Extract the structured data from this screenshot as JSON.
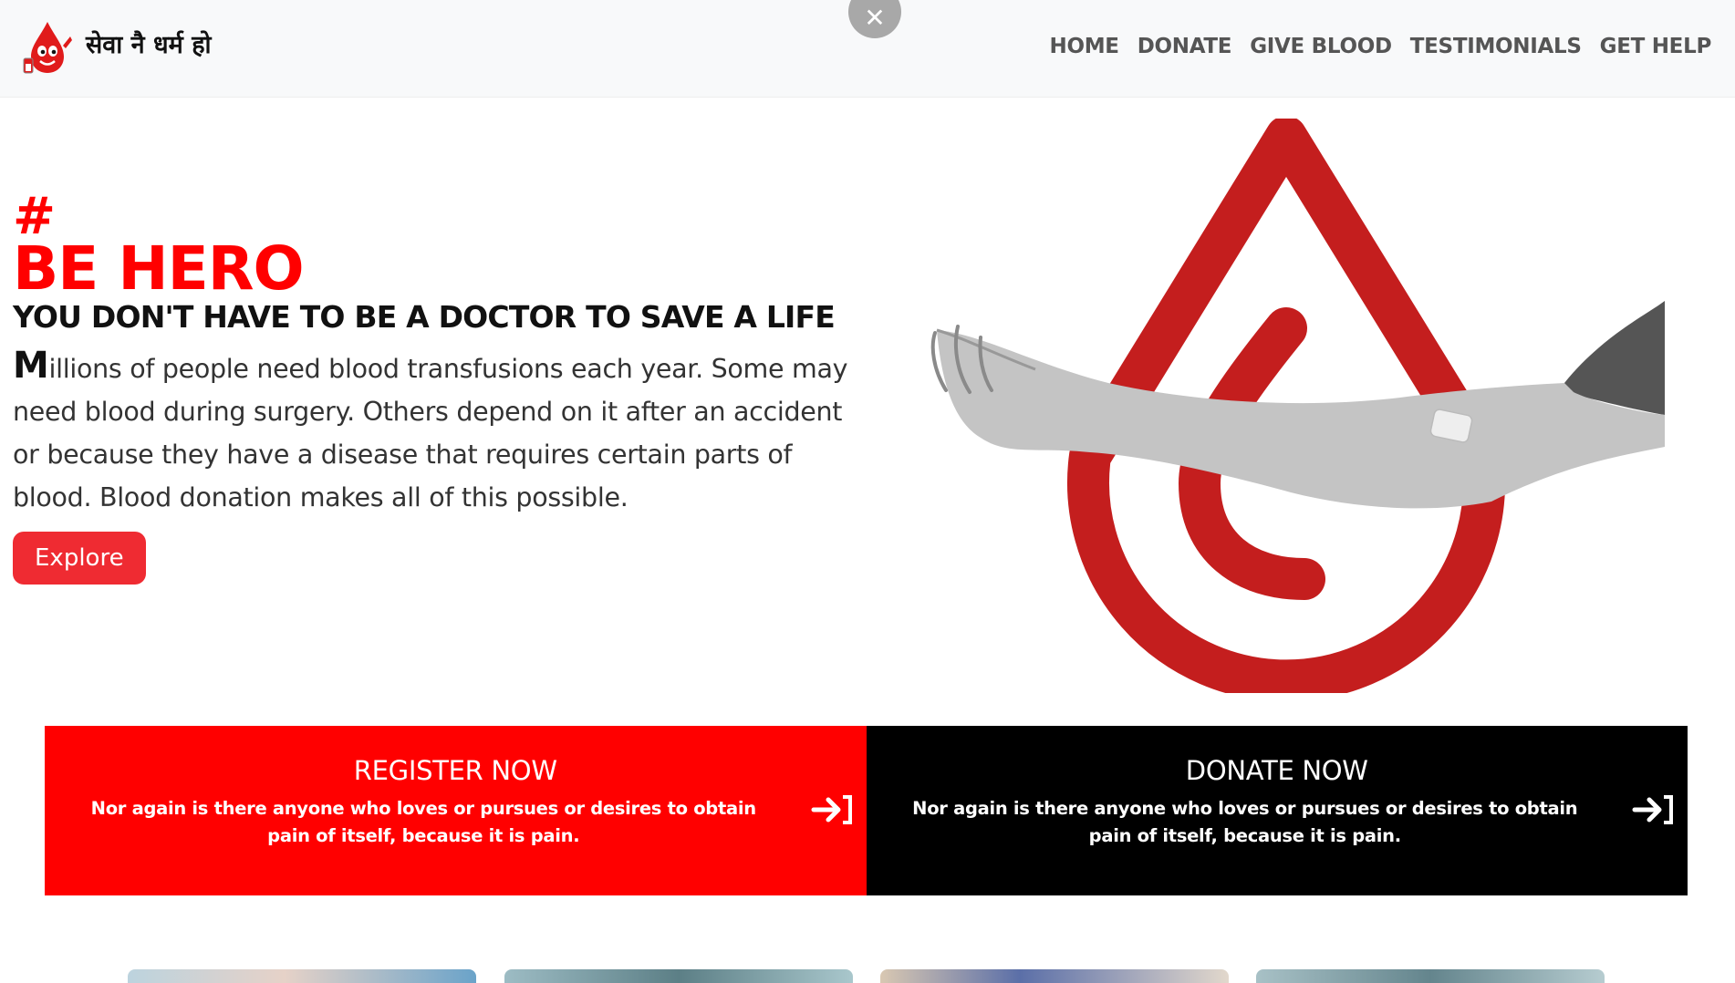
{
  "brand": {
    "text": "सेवा नै धर्म हो",
    "logo_icon": "blood-drop-mascot-icon"
  },
  "close_icon": "close-icon",
  "close_glyph": "✕",
  "nav": {
    "items": [
      {
        "label": "HOME"
      },
      {
        "label": "DONATE"
      },
      {
        "label": "GIVE BLOOD"
      },
      {
        "label": "TESTIMONIALS"
      },
      {
        "label": "GET HELP"
      }
    ]
  },
  "hero": {
    "hash": "#",
    "title": "BE HERO",
    "subtitle": "YOU DON'T HAVE TO BE A DOCTOR TO SAVE A LIFE",
    "dropcap": "M",
    "paragraph": "illions of people need blood transfusions each year. Some may need blood during surgery. Others depend on it after an accident or because they have a disease that requires certain parts of blood. Blood donation makes all of this possible.",
    "button_label": "Explore",
    "image_icon": "blood-drop-arm-illustration"
  },
  "cta": {
    "register": {
      "title": "REGISTER NOW",
      "text": "Nor again is there anyone who loves or pursues or desires to obtain pain of itself, because it is pain.",
      "icon": "sign-in-arrow-icon"
    },
    "donate": {
      "title": "DONATE NOW",
      "text": "Nor again is there anyone who loves or pursues or desires to obtain pain of itself, because it is pain.",
      "icon": "sign-in-arrow-icon"
    }
  },
  "colors": {
    "accent_red": "#ff0000",
    "button_red": "#ef2b32",
    "drop_red": "#c41e1e",
    "nav_bg": "#f8f9fa",
    "nav_text": "#555555"
  }
}
